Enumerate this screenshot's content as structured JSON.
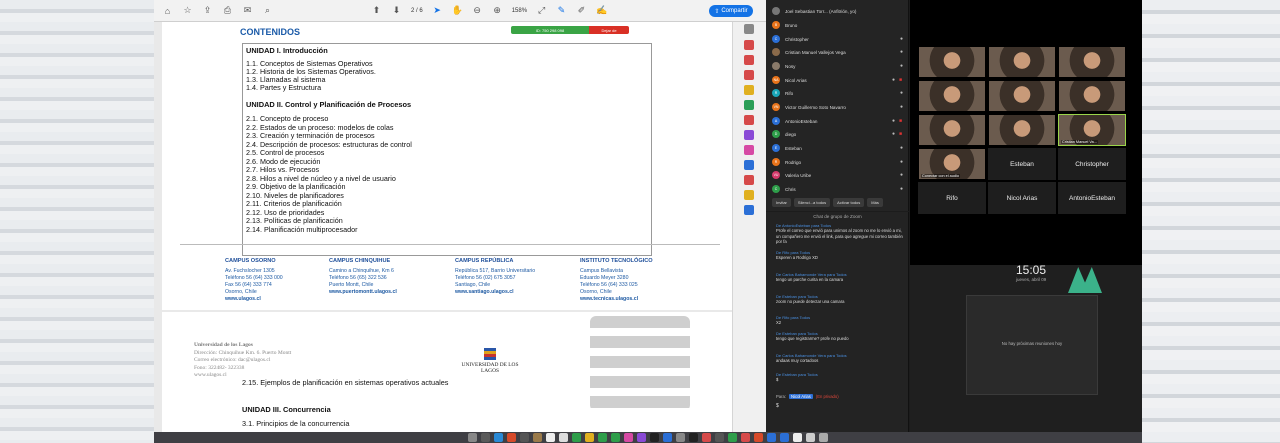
{
  "toolbar": {
    "page_indicator": "2 / 6",
    "zoom": "158%",
    "share_label": "Compartir"
  },
  "share_bar": {
    "meeting_id": "ID: 750 298 098",
    "stop_label": "Dejar de"
  },
  "document": {
    "heading": "CONTENIDOS",
    "unit1_title": "UNIDAD I. Introducción",
    "unit1_items": [
      "1.1. Conceptos de Sistemas Operativos",
      "1.2. Historia de los Sistemas Operativos.",
      "1.3. Llamadas al sistema",
      "1.4. Partes y Estructura"
    ],
    "unit2_title": "UNIDAD II. Control y Planificación de Procesos",
    "unit2_items": [
      "2.1. Concepto de proceso",
      "2.2. Estados de un proceso: modelos de colas",
      "2.3. Creación y terminación de procesos",
      "2.4. Descripción de procesos: estructuras de control",
      "2.5. Control de procesos",
      "2.6. Modo de ejecución",
      "2.7. Hilos vs. Procesos",
      "2.8. Hilos a nivel de núcleo y a nivel de usuario",
      "2.9. Objetivo de la planificación",
      "2.10. Niveles de planificadores",
      "2.11. Criterios de planificación",
      "2.12. Uso de prioridades",
      "2.13. Políticas de planificación",
      "2.14. Planificación multiprocesador"
    ],
    "campuses": [
      {
        "title": "CAMPUS OSORNO",
        "lines": [
          "Av. Fuchslocher 1305",
          "Teléfono 56 (64) 333 000",
          "Fax 56 (64) 333 774",
          "Osorno, Chile"
        ],
        "web": "www.ulagos.cl"
      },
      {
        "title": "CAMPUS CHINQUIHUE",
        "lines": [
          "Camino a Chinquihue, Km 6",
          "Teléfono 56 (65) 322 536",
          "Puerto Montt, Chile"
        ],
        "web": "www.puertomontt.ulagos.cl"
      },
      {
        "title": "CAMPUS REPÚBLICA",
        "lines": [
          "República 517, Barrio Universitario",
          "Teléfono 56 (02) 675 3057",
          "Santiago, Chile"
        ],
        "web": "www.santiago.ulagos.cl"
      },
      {
        "title": "INSTITUTO TECNOLÓGICO",
        "lines": [
          "Campus Bellavista",
          "Eduardo Meyer 3280",
          "Teléfono 56 (64) 333 025",
          "Osorno, Chile"
        ],
        "web": "www.tecnicas.ulagos.cl"
      }
    ],
    "page2_info": [
      "Universidad de los Lagos",
      "Dirección: Chinquihue Km. 6. Puerto Montt",
      "Correo electrónico: dac@ulagos.cl",
      "Fono: 322482- 322338",
      "www.ulagos.cl"
    ],
    "page2_logo": "UNIVERSIDAD DE LOS LAGOS",
    "page2_item": "2.15. Ejemplos de planificación en sistemas operativos actuales",
    "unit3_title": "UNIDAD III. Concurrencia",
    "unit3_item": "3.1. Principios de la concurrencia"
  },
  "participants": [
    {
      "name": "Joel Sebastian Torr... (Anfitrión, yo)",
      "initials": "",
      "color": "#777"
    },
    {
      "name": "Bruno",
      "initials": "B",
      "color": "#e8731a"
    },
    {
      "name": "Christopher",
      "initials": "C",
      "color": "#2b6fd6"
    },
    {
      "name": "Cristian Manuel Vallejos Vega",
      "initials": "",
      "color": "#8a6a4a"
    },
    {
      "name": "Nosy",
      "initials": "",
      "color": "#8a7a6a"
    },
    {
      "name": "Nicol Arias",
      "initials": "NA",
      "color": "#e8731a"
    },
    {
      "name": "Rifo",
      "initials": "R",
      "color": "#1aa5b8"
    },
    {
      "name": "Victor Guillermo Soto Navarro",
      "initials": "VN",
      "color": "#e8731a"
    },
    {
      "name": "AntonioEsteban",
      "initials": "A",
      "color": "#2b6fd6"
    },
    {
      "name": "diego",
      "initials": "D",
      "color": "#2e9e4a"
    },
    {
      "name": "Esteban",
      "initials": "E",
      "color": "#2b6fd6"
    },
    {
      "name": "Rodrigo",
      "initials": "R",
      "color": "#e8731a"
    },
    {
      "name": "Valeria Uribe",
      "initials": "VU",
      "color": "#d4386a"
    },
    {
      "name": "Chris",
      "initials": "C",
      "color": "#2e9e4a"
    }
  ],
  "participant_buttons": [
    "Invitar",
    "Silenci...a todos",
    "Activar todos",
    "Más"
  ],
  "chat": {
    "title": "Chat de grupo de Zoom",
    "messages": [
      {
        "from": "De AntonioEsteban para Todos",
        "text": "Profe el correo que envió para unirnos al zoom no me lo envió a mi, un compañero me envió el link, para que agregue mi correo también por fa"
      },
      {
        "from": "De Rifo para Todos",
        "text": "Esperen a Rodrigo XD"
      },
      {
        "from": "De Carlos Bahamonde Vera para Todos",
        "text": "tengo un parche curita en la camara"
      },
      {
        "from": "De Esteban para Todos",
        "text": "zoom no puede detectar una camara"
      },
      {
        "from": "De Rifo para Todos",
        "text": "X2"
      },
      {
        "from": "De Esteban para Todos",
        "text": "tengo que registrarme? profe no puedo"
      },
      {
        "from": "De Carlos Bahamonde Vera para Todos",
        "text": "andaas muy cortadoos"
      },
      {
        "from": "De Esteban para Todos",
        "text": "$"
      }
    ],
    "to_label": "Para:",
    "to_value": "Nicol Arias",
    "private_label": "(En privado)",
    "input_value": "$"
  },
  "gallery": {
    "tiles_named": [
      "Esteban",
      "Christopher",
      "Rifo",
      "Nicol Arias",
      "AntonioEsteban"
    ],
    "label_active": "Cristian Manuel Va...",
    "label_connect": "Conectar con el audio"
  },
  "calendar": {
    "time": "15:05",
    "date": "jueves, abril 09",
    "empty": "No hay próximas reuniones hoy"
  }
}
